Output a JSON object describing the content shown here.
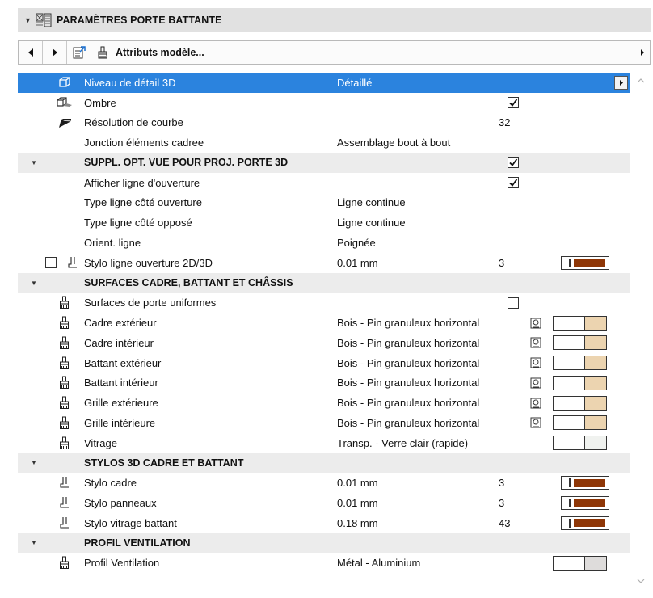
{
  "panel": {
    "title": "PARAMÈTRES PORTE BATTANTE"
  },
  "toolbar": {
    "attributes_label": "Attributs modèle..."
  },
  "colors": {
    "selection": "#2b83de",
    "pen_fill": "#8e3606",
    "material_tan": "#ecd4b0",
    "glass": "#f0f2ef",
    "metal": "#dedcdb"
  },
  "rows": [
    {
      "kind": "param",
      "icon": "detail-3d-icon",
      "name": "Niveau de détail 3D",
      "value": "Détaillé",
      "selected": true,
      "expand": true
    },
    {
      "kind": "param",
      "icon": "shadow-icon",
      "name": "Ombre",
      "check": true
    },
    {
      "kind": "param",
      "icon": "curve-resolution-icon",
      "name": "Résolution de courbe",
      "num": "32"
    },
    {
      "kind": "param",
      "name": "Jonction éléments cadree",
      "value": "Assemblage bout à bout"
    },
    {
      "kind": "section",
      "name": "SUPPL. OPT. VUE POUR PROJ. PORTE 3D",
      "check": true
    },
    {
      "kind": "param",
      "name": "Afficher ligne d'ouverture",
      "check": true
    },
    {
      "kind": "param",
      "name": "Type ligne côté ouverture",
      "value": "Ligne continue"
    },
    {
      "kind": "param",
      "name": "Type ligne côté opposé",
      "value": "Ligne continue"
    },
    {
      "kind": "param",
      "name": "Orient. ligne",
      "value": "Poignée"
    },
    {
      "kind": "param",
      "icon": "pen-icon",
      "lock": true,
      "name": "Stylo ligne ouverture 2D/3D",
      "value": "0.01 mm",
      "num": "3",
      "pen": true
    },
    {
      "kind": "section",
      "name": "SURFACES CADRE, BATTANT ET CHÂSSIS"
    },
    {
      "kind": "param",
      "icon": "surface-brush-icon",
      "name": "Surfaces de porte uniformes",
      "check": false
    },
    {
      "kind": "param",
      "icon": "surface-brush-icon",
      "name": "Cadre extérieur",
      "value": "Bois - Pin granuleux horizontal",
      "mat": "wood"
    },
    {
      "kind": "param",
      "icon": "surface-brush-icon",
      "name": "Cadre intérieur",
      "value": "Bois - Pin granuleux horizontal",
      "mat": "wood"
    },
    {
      "kind": "param",
      "icon": "surface-brush-icon",
      "name": "Battant extérieur",
      "value": "Bois - Pin granuleux horizontal",
      "mat": "wood"
    },
    {
      "kind": "param",
      "icon": "surface-brush-icon",
      "name": "Battant intérieur",
      "value": "Bois - Pin granuleux horizontal",
      "mat": "wood"
    },
    {
      "kind": "param",
      "icon": "surface-brush-icon",
      "name": "Grille extérieure",
      "value": "Bois - Pin granuleux horizontal",
      "mat": "wood"
    },
    {
      "kind": "param",
      "icon": "surface-brush-icon",
      "name": "Grille intérieure",
      "value": "Bois - Pin granuleux horizontal",
      "mat": "wood"
    },
    {
      "kind": "param",
      "icon": "surface-brush-icon",
      "name": "Vitrage",
      "value": "Transp. - Verre clair (rapide)",
      "mat": "glass"
    },
    {
      "kind": "section",
      "name": "STYLOS 3D CADRE ET BATTANT"
    },
    {
      "kind": "param",
      "icon": "pen-icon",
      "name": "Stylo cadre",
      "value": "0.01 mm",
      "num": "3",
      "pen": true
    },
    {
      "kind": "param",
      "icon": "pen-icon",
      "name": "Stylo panneaux",
      "value": "0.01 mm",
      "num": "3",
      "pen": true
    },
    {
      "kind": "param",
      "icon": "pen-icon",
      "name": "Stylo vitrage battant",
      "value": "0.18 mm",
      "num": "43",
      "pen": true
    },
    {
      "kind": "section",
      "name": "PROFIL VENTILATION"
    },
    {
      "kind": "param",
      "icon": "surface-brush-icon",
      "name": "Profil Ventilation",
      "value": "Métal - Aluminium",
      "mat": "metal"
    }
  ]
}
